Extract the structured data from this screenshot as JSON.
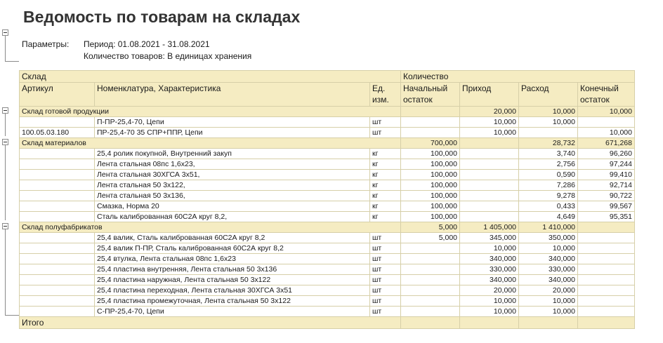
{
  "report": {
    "title": "Ведомость по товарам на складах",
    "params_label": "Параметры:",
    "period": "Период: 01.08.2021 - 31.08.2021",
    "quantity_mode": "Количество товаров: В единицах хранения"
  },
  "headers": {
    "warehouse": "Склад",
    "quantity": "Количество",
    "article": "Артикул",
    "nomenclature": "Номенклатура, Характеристика",
    "unit_line1": "Ед.",
    "unit_line2": "изм.",
    "start_line1": "Начальный",
    "start_line2": "остаток",
    "income": "Приход",
    "expense": "Расход",
    "end_line1": "Конечный",
    "end_line2": "остаток"
  },
  "groups": [
    {
      "name": "Склад готовой продукции",
      "start": "",
      "income": "20,000",
      "expense": "10,000",
      "end": "10,000",
      "rows": [
        {
          "article": "",
          "name": "П-ПР-25,4-70, Цепи",
          "unit": "шт",
          "start": "",
          "income": "10,000",
          "expense": "10,000",
          "end": ""
        },
        {
          "article": "100.05.03.180",
          "name": "ПР-25,4-70 35 СПР+ППР, Цепи",
          "unit": "шт",
          "start": "",
          "income": "10,000",
          "expense": "",
          "end": "10,000"
        }
      ]
    },
    {
      "name": "Склад материалов",
      "start": "700,000",
      "income": "",
      "expense": "28,732",
      "end": "671,268",
      "rows": [
        {
          "article": "",
          "name": "25,4 ролик покупной, Внутренний закуп",
          "unit": "кг",
          "start": "100,000",
          "income": "",
          "expense": "3,740",
          "end": "96,260"
        },
        {
          "article": "",
          "name": "Лента стальная 08пс 1,6х23,",
          "unit": "кг",
          "start": "100,000",
          "income": "",
          "expense": "2,756",
          "end": "97,244"
        },
        {
          "article": "",
          "name": "Лента стальная 30ХГСА 3х51,",
          "unit": "кг",
          "start": "100,000",
          "income": "",
          "expense": "0,590",
          "end": "99,410"
        },
        {
          "article": "",
          "name": "Лента стальная 50 3х122,",
          "unit": "кг",
          "start": "100,000",
          "income": "",
          "expense": "7,286",
          "end": "92,714"
        },
        {
          "article": "",
          "name": "Лента стальная 50 3х136,",
          "unit": "кг",
          "start": "100,000",
          "income": "",
          "expense": "9,278",
          "end": "90,722"
        },
        {
          "article": "",
          "name": "Смазка, Норма 20",
          "unit": "кг",
          "start": "100,000",
          "income": "",
          "expense": "0,433",
          "end": "99,567"
        },
        {
          "article": "",
          "name": "Сталь калиброванная 60С2А круг 8,2,",
          "unit": "кг",
          "start": "100,000",
          "income": "",
          "expense": "4,649",
          "end": "95,351"
        }
      ]
    },
    {
      "name": "Склад полуфабрикатов",
      "start": "5,000",
      "income": "1 405,000",
      "expense": "1 410,000",
      "end": "",
      "rows": [
        {
          "article": "",
          "name": "25,4 валик, Сталь калиброванная 60С2А круг 8,2",
          "unit": "шт",
          "start": "5,000",
          "income": "345,000",
          "expense": "350,000",
          "end": ""
        },
        {
          "article": "",
          "name": "25,4 валик П-ПР, Сталь калиброванная 60С2А круг 8,2",
          "unit": "шт",
          "start": "",
          "income": "10,000",
          "expense": "10,000",
          "end": ""
        },
        {
          "article": "",
          "name": "25,4 втулка, Лента стальная 08пс 1,6х23",
          "unit": "шт",
          "start": "",
          "income": "340,000",
          "expense": "340,000",
          "end": ""
        },
        {
          "article": "",
          "name": "25,4 пластина внутренняя, Лента стальная 50 3х136",
          "unit": "шт",
          "start": "",
          "income": "330,000",
          "expense": "330,000",
          "end": ""
        },
        {
          "article": "",
          "name": "25,4 пластина наружная, Лента стальная 50 3х122",
          "unit": "шт",
          "start": "",
          "income": "340,000",
          "expense": "340,000",
          "end": ""
        },
        {
          "article": "",
          "name": "25,4 пластина переходная, Лента стальная 30ХГСА 3х51",
          "unit": "шт",
          "start": "",
          "income": "20,000",
          "expense": "20,000",
          "end": ""
        },
        {
          "article": "",
          "name": "25,4 пластина промежуточная, Лента стальная 50 3х122",
          "unit": "шт",
          "start": "",
          "income": "10,000",
          "expense": "10,000",
          "end": ""
        },
        {
          "article": "",
          "name": "С-ПР-25,4-70, Цепи",
          "unit": "шт",
          "start": "",
          "income": "10,000",
          "expense": "10,000",
          "end": ""
        }
      ]
    }
  ],
  "total_label": "Итого"
}
